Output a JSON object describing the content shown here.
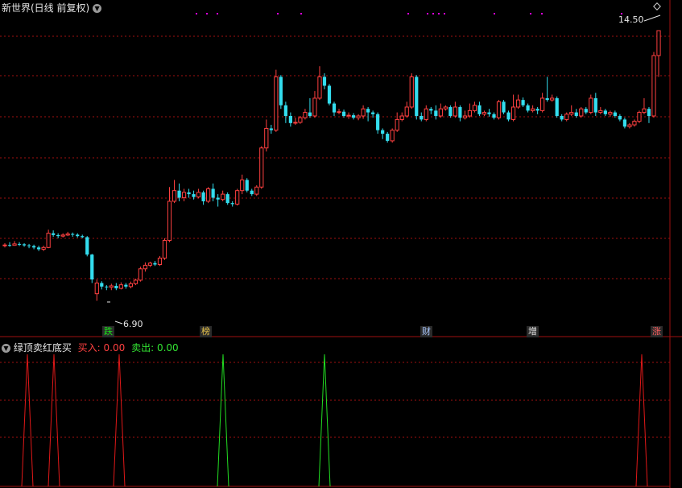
{
  "main_panel": {
    "title": "新世界(日线 前复权)",
    "tags": [
      {
        "text": "跌"
      },
      {
        "text": "榜"
      },
      {
        "text": "财"
      },
      {
        "text": "增"
      },
      {
        "text": "涨"
      }
    ]
  },
  "indicator_panel": {
    "title": "绿顶卖红底买",
    "buy": {
      "label": "买入: ",
      "value": "0.00"
    },
    "sell": {
      "label": "卖出: ",
      "value": "0.00"
    }
  },
  "chart": {
    "annotations": {
      "low_label": "6.90",
      "high_label": "14.50"
    }
  },
  "colors": {
    "background": "#000000",
    "up": "#ff4040",
    "down": "#33ddee",
    "grid": "#a01010",
    "buy_spike": "#e01818",
    "sell_spike": "#22dd22",
    "dot": "#dd00dd"
  },
  "chart_data": [
    {
      "type": "candlestick",
      "ylim": [
        6.3,
        15.0
      ],
      "low": 6.9,
      "high": 14.5,
      "candles": [
        [
          8.45,
          8.47,
          8.52,
          8.4
        ],
        [
          8.47,
          8.46,
          8.55,
          8.42
        ],
        [
          8.46,
          8.5,
          8.58,
          8.45
        ],
        [
          8.5,
          8.49,
          8.55,
          8.44
        ],
        [
          8.49,
          8.46,
          8.52,
          8.42
        ],
        [
          8.46,
          8.44,
          8.5,
          8.38
        ],
        [
          8.44,
          8.4,
          8.48,
          8.35
        ],
        [
          8.4,
          8.35,
          8.45,
          8.3
        ],
        [
          8.35,
          8.4,
          8.45,
          8.3
        ],
        [
          8.4,
          8.8,
          8.9,
          8.38
        ],
        [
          8.8,
          8.75,
          8.88,
          8.7
        ],
        [
          8.75,
          8.72,
          8.8,
          8.66
        ],
        [
          8.72,
          8.75,
          8.8,
          8.68
        ],
        [
          8.75,
          8.78,
          8.84,
          8.72
        ],
        [
          8.78,
          8.76,
          8.82,
          8.7
        ],
        [
          8.76,
          8.72,
          8.8,
          8.68
        ],
        [
          8.72,
          8.69,
          8.76,
          8.66
        ],
        [
          8.69,
          8.2,
          8.72,
          8.15
        ],
        [
          8.2,
          7.5,
          8.22,
          7.4
        ],
        [
          7.1,
          7.4,
          7.5,
          6.9
        ],
        [
          7.4,
          7.3,
          7.45,
          7.22
        ],
        [
          7.3,
          7.28,
          7.34,
          7.2
        ],
        [
          7.28,
          7.32,
          7.38,
          7.2
        ],
        [
          7.32,
          7.25,
          7.4,
          7.2
        ],
        [
          7.25,
          7.35,
          7.42,
          7.22
        ],
        [
          7.35,
          7.3,
          7.4,
          7.24
        ],
        [
          7.3,
          7.38,
          7.44,
          7.25
        ],
        [
          7.38,
          7.48,
          7.52,
          7.34
        ],
        [
          7.48,
          7.8,
          7.86,
          7.44
        ],
        [
          7.8,
          7.9,
          7.98,
          7.72
        ],
        [
          7.9,
          7.96,
          8.0,
          7.85
        ],
        [
          7.96,
          7.92,
          8.02,
          7.88
        ],
        [
          7.92,
          8.1,
          8.16,
          7.88
        ],
        [
          8.1,
          8.6,
          8.66,
          8.05
        ],
        [
          8.6,
          9.7,
          10.1,
          8.55
        ],
        [
          9.7,
          10.0,
          10.3,
          9.65
        ],
        [
          10.0,
          9.8,
          10.2,
          9.7
        ],
        [
          9.8,
          9.95,
          10.05,
          9.7
        ],
        [
          9.95,
          9.9,
          10.05,
          9.8
        ],
        [
          9.9,
          9.82,
          10.0,
          9.75
        ],
        [
          9.82,
          9.95,
          10.05,
          9.78
        ],
        [
          9.95,
          9.7,
          10.0,
          9.6
        ],
        [
          9.7,
          10.05,
          10.1,
          9.65
        ],
        [
          10.05,
          9.8,
          10.2,
          9.7
        ],
        [
          9.8,
          9.75,
          9.9,
          9.55
        ],
        [
          9.75,
          9.9,
          10.0,
          9.7
        ],
        [
          9.9,
          9.65,
          9.95,
          9.6
        ],
        [
          9.65,
          9.62,
          9.7,
          9.55
        ],
        [
          9.62,
          10.0,
          10.05,
          9.58
        ],
        [
          10.0,
          10.3,
          10.45,
          9.9
        ],
        [
          10.3,
          10.0,
          10.35,
          9.95
        ],
        [
          10.0,
          9.9,
          10.05,
          9.85
        ],
        [
          9.9,
          10.1,
          10.15,
          9.85
        ],
        [
          10.1,
          11.2,
          11.25,
          10.05
        ],
        [
          11.2,
          11.75,
          12.0,
          11.1
        ],
        [
          11.75,
          11.7,
          11.85,
          11.6
        ],
        [
          11.7,
          13.2,
          13.4,
          11.65
        ],
        [
          13.2,
          12.4,
          13.25,
          12.3
        ],
        [
          12.4,
          12.1,
          12.5,
          11.9
        ],
        [
          12.1,
          11.9,
          12.2,
          11.8
        ],
        [
          11.9,
          11.92,
          12.05,
          11.85
        ],
        [
          11.92,
          12.05,
          12.1,
          11.88
        ],
        [
          12.05,
          12.2,
          12.3,
          12.0
        ],
        [
          12.2,
          12.1,
          12.6,
          12.05
        ],
        [
          12.1,
          12.6,
          12.8,
          12.05
        ],
        [
          12.6,
          13.2,
          13.5,
          12.55
        ],
        [
          13.2,
          12.95,
          13.3,
          12.85
        ],
        [
          12.95,
          12.45,
          13.0,
          12.4
        ],
        [
          12.45,
          12.2,
          12.5,
          12.1
        ],
        [
          12.2,
          12.22,
          12.3,
          12.15
        ],
        [
          12.22,
          12.1,
          12.28,
          12.05
        ],
        [
          12.1,
          12.12,
          12.2,
          12.02
        ],
        [
          12.12,
          12.05,
          12.18,
          12.0
        ],
        [
          12.05,
          12.1,
          12.15,
          11.98
        ],
        [
          12.1,
          12.3,
          12.4,
          12.02
        ],
        [
          12.3,
          12.2,
          12.35,
          11.95
        ],
        [
          12.2,
          12.15,
          12.25,
          12.05
        ],
        [
          12.15,
          11.7,
          12.2,
          11.6
        ],
        [
          11.7,
          11.6,
          11.75,
          11.45
        ],
        [
          11.6,
          11.4,
          11.65,
          11.35
        ],
        [
          11.4,
          11.7,
          11.75,
          11.35
        ],
        [
          11.7,
          12.0,
          12.2,
          11.65
        ],
        [
          12.0,
          12.1,
          12.2,
          11.95
        ],
        [
          12.1,
          12.35,
          12.5,
          12.05
        ],
        [
          12.35,
          13.2,
          13.3,
          12.3
        ],
        [
          13.2,
          12.1,
          13.25,
          12.0
        ],
        [
          12.1,
          12.0,
          12.2,
          11.95
        ],
        [
          12.0,
          12.3,
          12.4,
          11.95
        ],
        [
          12.3,
          12.25,
          12.35,
          12.15
        ],
        [
          12.25,
          12.1,
          12.4,
          12.0
        ],
        [
          12.1,
          12.3,
          12.45,
          12.05
        ],
        [
          12.3,
          12.35,
          12.4,
          12.25
        ],
        [
          12.35,
          12.1,
          12.4,
          12.05
        ],
        [
          12.1,
          12.35,
          12.5,
          12.05
        ],
        [
          12.35,
          12.05,
          12.4,
          11.95
        ],
        [
          12.05,
          12.1,
          12.25,
          12.0
        ],
        [
          12.1,
          12.25,
          12.45,
          12.05
        ],
        [
          12.25,
          12.4,
          12.5,
          12.2
        ],
        [
          12.4,
          12.15,
          12.5,
          12.1
        ],
        [
          12.15,
          12.2,
          12.25,
          12.1
        ],
        [
          12.2,
          12.15,
          12.3,
          12.08
        ],
        [
          12.15,
          12.05,
          12.2,
          12.0
        ],
        [
          12.05,
          12.5,
          12.55,
          12.0
        ],
        [
          12.5,
          12.2,
          12.55,
          12.15
        ],
        [
          12.2,
          12.0,
          12.25,
          11.95
        ],
        [
          12.0,
          12.35,
          12.7,
          11.95
        ],
        [
          12.35,
          12.55,
          12.7,
          12.3
        ],
        [
          12.55,
          12.4,
          12.62,
          12.35
        ],
        [
          12.4,
          12.25,
          12.45,
          12.2
        ],
        [
          12.25,
          12.3,
          12.4,
          12.2
        ],
        [
          12.3,
          12.25,
          12.35,
          12.15
        ],
        [
          12.25,
          12.6,
          12.75,
          12.2
        ],
        [
          12.6,
          12.55,
          13.2,
          12.5
        ],
        [
          12.55,
          12.6,
          12.7,
          12.5
        ],
        [
          12.6,
          12.1,
          12.65,
          12.05
        ],
        [
          12.1,
          12.0,
          12.15,
          11.95
        ],
        [
          12.0,
          12.15,
          12.2,
          11.95
        ],
        [
          12.15,
          12.2,
          12.4,
          12.1
        ],
        [
          12.2,
          12.1,
          12.3,
          12.05
        ],
        [
          12.1,
          12.3,
          12.35,
          12.05
        ],
        [
          12.3,
          12.2,
          12.35,
          12.15
        ],
        [
          12.2,
          12.6,
          12.7,
          12.15
        ],
        [
          12.6,
          12.2,
          12.75,
          12.1
        ],
        [
          12.2,
          12.25,
          12.35,
          12.15
        ],
        [
          12.25,
          12.15,
          12.3,
          12.1
        ],
        [
          12.15,
          12.2,
          12.25,
          12.08
        ],
        [
          12.2,
          12.1,
          12.25,
          12.05
        ],
        [
          12.1,
          12.0,
          12.15,
          11.95
        ],
        [
          12.0,
          11.8,
          12.05,
          11.75
        ],
        [
          11.8,
          11.85,
          11.9,
          11.75
        ],
        [
          11.85,
          11.95,
          12.0,
          11.8
        ],
        [
          11.95,
          12.2,
          12.25,
          11.9
        ],
        [
          12.2,
          12.3,
          12.6,
          12.15
        ],
        [
          12.3,
          12.1,
          12.35,
          11.9
        ],
        [
          12.1,
          13.8,
          13.9,
          12.05
        ],
        [
          13.8,
          14.5,
          14.5,
          13.2
        ]
      ]
    },
    {
      "type": "line",
      "title": "绿顶卖红底买",
      "series": [
        {
          "name": "买入",
          "peaks_at_index": [
            11,
            21,
            52,
            263
          ],
          "height": 1.0
        },
        {
          "name": "卖出",
          "peaks_at_index": [
            91,
            133
          ],
          "height": 1.0
        }
      ],
      "values": {
        "买入": 0.0,
        "卖出": 0.0
      }
    }
  ]
}
